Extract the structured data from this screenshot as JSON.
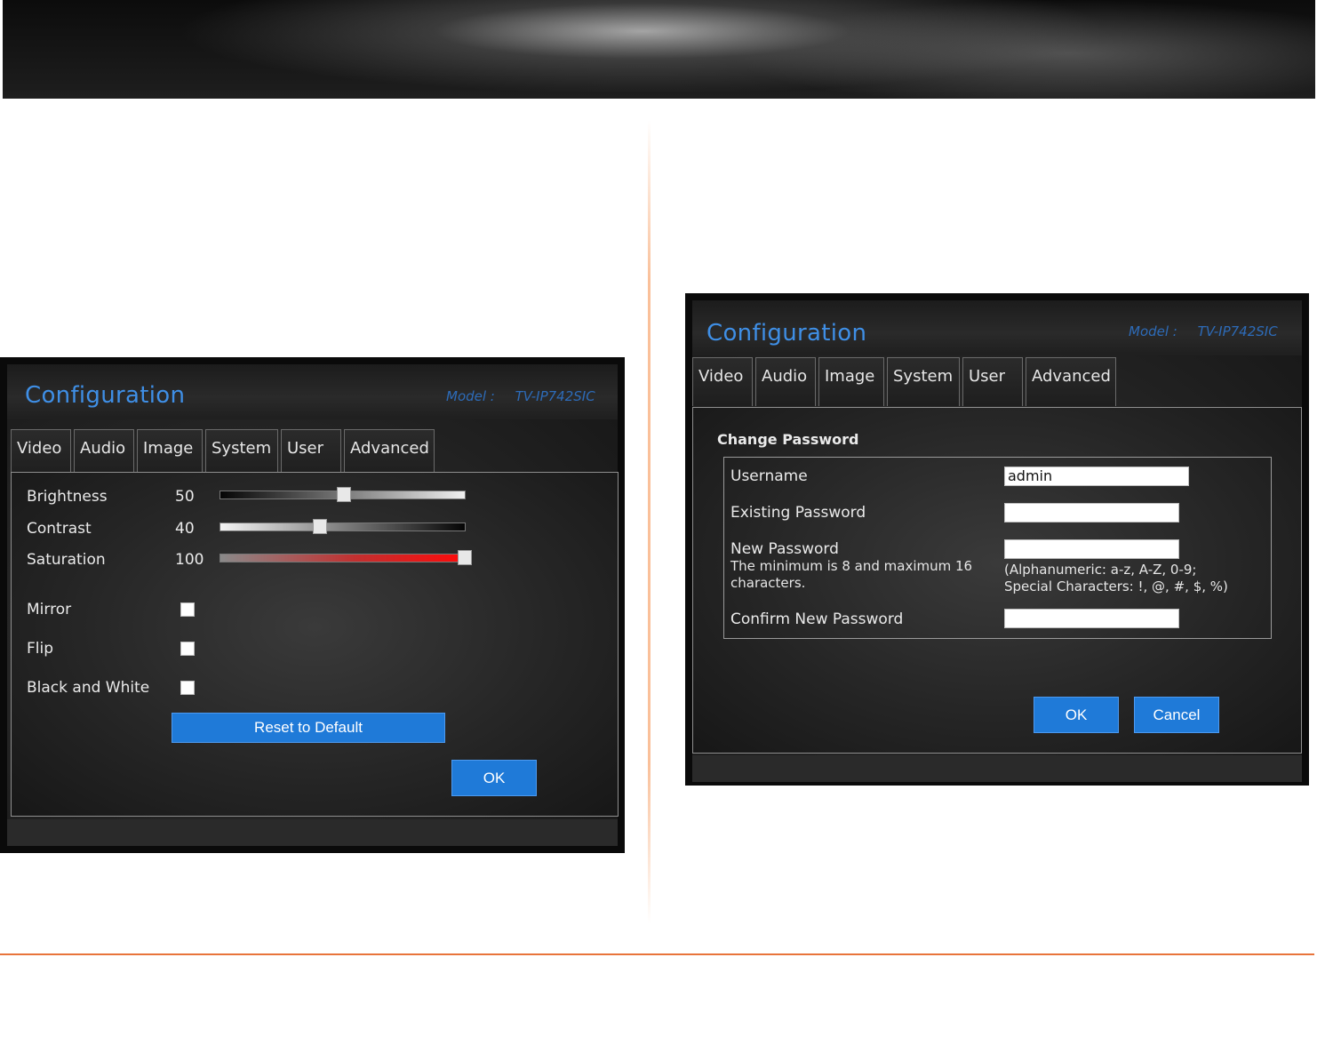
{
  "left_window": {
    "title": "Configuration",
    "model_label": "Model :",
    "model_value": "TV-IP742SIC",
    "tabs": [
      "Video",
      "Audio",
      "Image",
      "System",
      "User",
      "Advanced"
    ],
    "image_settings": {
      "brightness": {
        "label": "Brightness",
        "value": "50",
        "level_percent": 50
      },
      "contrast": {
        "label": "Contrast",
        "value": "40",
        "level_percent": 40
      },
      "saturation": {
        "label": "Saturation",
        "value": "100",
        "level_percent": 100
      },
      "mirror": {
        "label": "Mirror",
        "checked": false
      },
      "flip": {
        "label": "Flip",
        "checked": false
      },
      "black_and_white": {
        "label": "Black and White",
        "checked": false
      }
    },
    "reset_label": "Reset to Default",
    "ok_label": "OK"
  },
  "right_window": {
    "title": "Configuration",
    "model_label": "Model :",
    "model_value": "TV-IP742SIC",
    "tabs": [
      "Video",
      "Audio",
      "Image",
      "System",
      "User",
      "Advanced"
    ],
    "section_title": "Change Password",
    "username_label": "Username",
    "username_value": "admin",
    "existing_password_label": "Existing Password",
    "new_password_label": "New Password",
    "new_password_hint_1": "The minimum is 8 and maximum 16",
    "new_password_hint_2": "characters.",
    "allowed_chars_1": "(Alphanumeric: a-z, A-Z, 0-9;",
    "allowed_chars_2": "Special Characters: !, @, #, $, %)",
    "confirm_password_label": "Confirm New Password",
    "ok_label": "OK",
    "cancel_label": "Cancel"
  },
  "colors": {
    "accent_blue": "#1f7ad8",
    "title_blue": "#3f8fe6",
    "footer_orange": "#e8743b",
    "saturation_red": "#e01818"
  }
}
